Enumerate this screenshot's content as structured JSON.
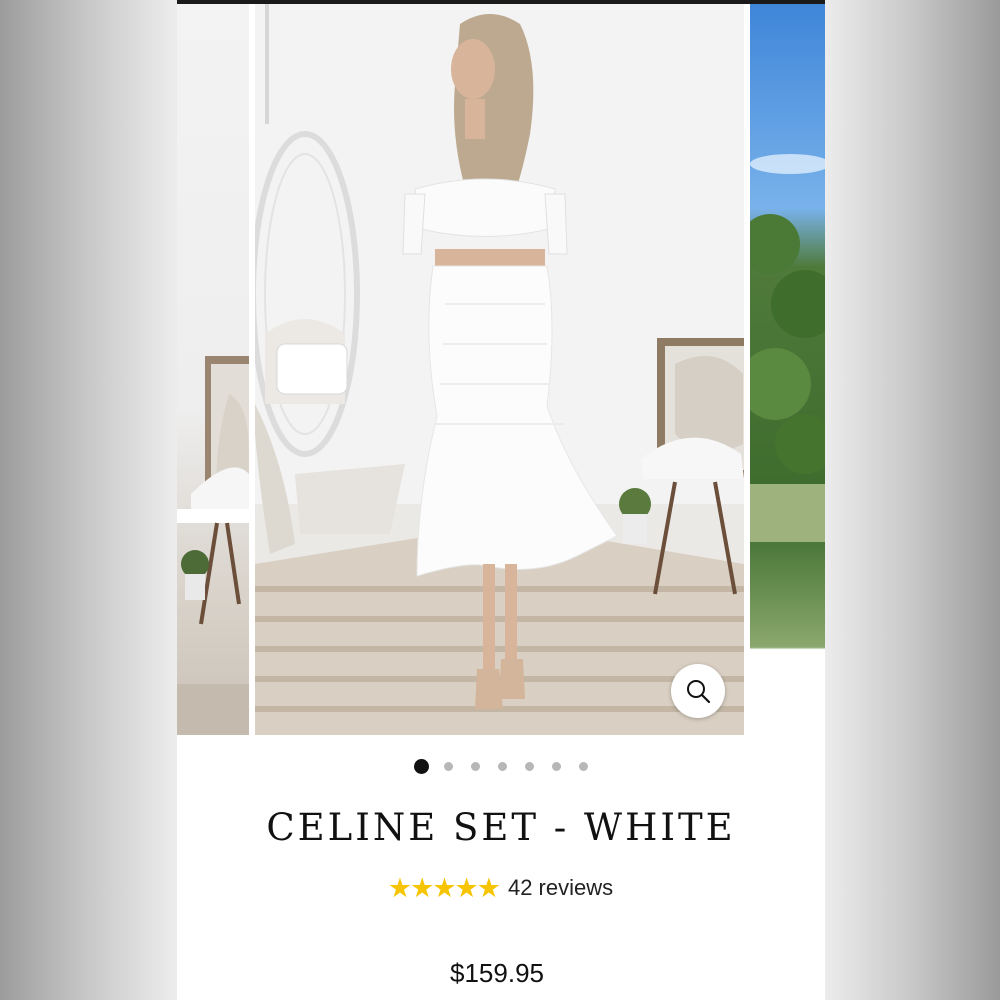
{
  "product": {
    "title": "CELINE SET - WHITE",
    "rating_stars": 5,
    "reviews_label": "42 reviews",
    "price": "$159.95"
  },
  "gallery": {
    "image_count": 7,
    "active_index": 0,
    "zoom_icon": "search-icon"
  },
  "colors": {
    "star": "#f6c500",
    "active_dot": "#111111",
    "inactive_dot": "#b7b7b7"
  }
}
